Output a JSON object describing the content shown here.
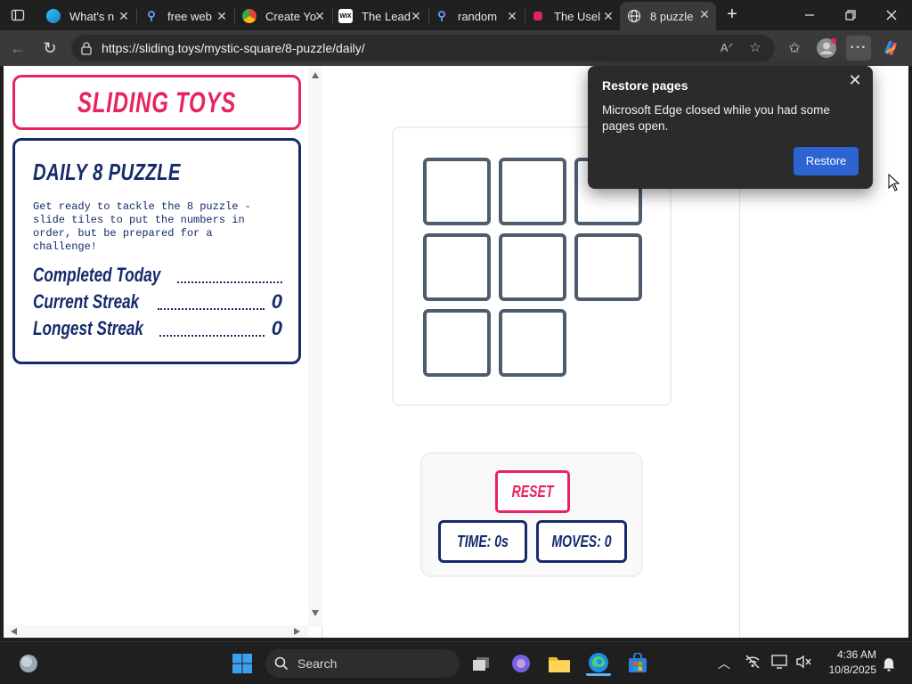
{
  "browser": {
    "tabs": [
      {
        "title": "What's n",
        "icon": "edge-icon",
        "active": false
      },
      {
        "title": "free web",
        "icon": "search-icon",
        "active": false
      },
      {
        "title": "Create Yo",
        "icon": "chrome-icon",
        "active": false
      },
      {
        "title": "The Lead",
        "icon": "wix-icon",
        "active": false
      },
      {
        "title": "random",
        "icon": "search-icon",
        "active": false
      },
      {
        "title": "The Usel",
        "icon": "useless-web-icon",
        "active": false
      },
      {
        "title": "8 puzzle",
        "icon": "globe-icon",
        "active": true
      }
    ],
    "url": "https://sliding.toys/mystic-square/8-puzzle/daily/"
  },
  "sidebar": {
    "logo": "SLIDING TOYS",
    "title": "DAILY 8 PUZZLE",
    "description": "Get ready to tackle the 8 puzzle - slide tiles to put the numbers in order, but be prepared for a challenge!",
    "stats": [
      {
        "label": "Completed Today",
        "value": ""
      },
      {
        "label": "Current Streak",
        "value": "0"
      },
      {
        "label": "Longest Streak",
        "value": "0"
      }
    ]
  },
  "game": {
    "tiles": 8,
    "reset_label": "RESET",
    "time_label": "TIME: 0s",
    "moves_label": "MOVES: 0"
  },
  "popup": {
    "title": "Restore pages",
    "message": "Microsoft Edge closed while you had some pages open.",
    "button": "Restore"
  },
  "taskbar": {
    "search_placeholder": "Search",
    "time": "4:36 AM",
    "date": "10/8/2025"
  },
  "colors": {
    "brand_pink": "#e8245f",
    "brand_navy": "#142a6b",
    "tile_border": "#4d5d6e",
    "restore_blue": "#2c64d4"
  }
}
